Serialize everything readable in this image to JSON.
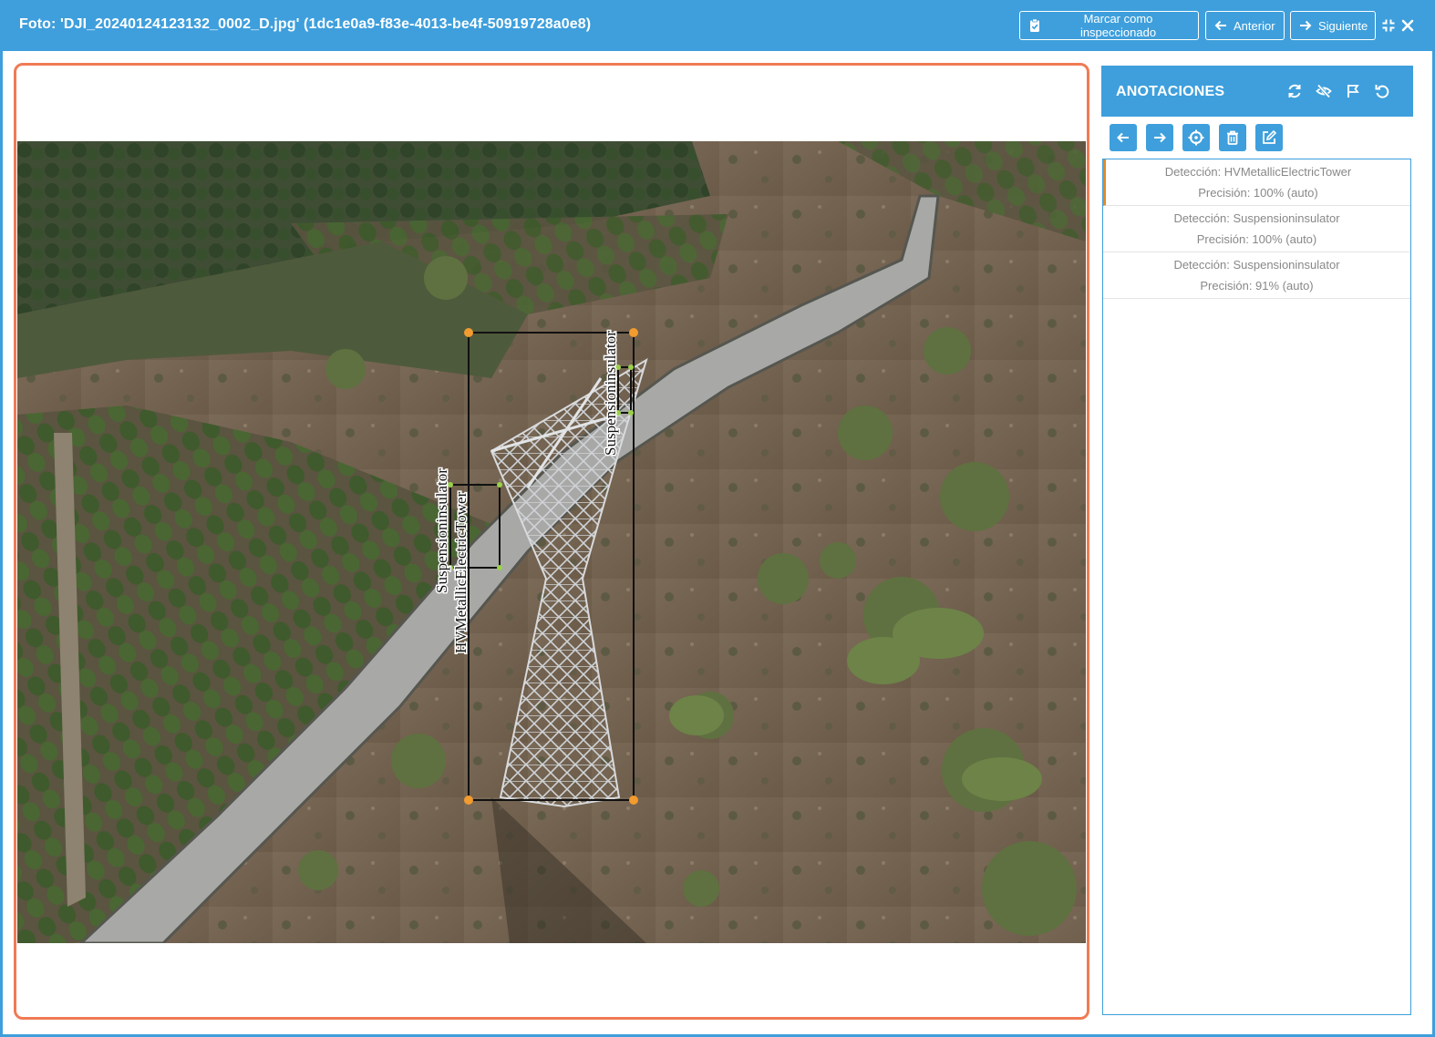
{
  "header": {
    "title": "Foto: 'DJI_20240124123132_0002_D.jpg' (1dc1e0a9-f83e-4013-be4f-50919728a0e8)",
    "buttons": {
      "mark_inspected": "Marcar como inspeccionado",
      "previous": "Anterior",
      "next": "Siguiente"
    },
    "icons": {
      "collapse": "collapse-icon",
      "close": "close-icon"
    }
  },
  "colors": {
    "brand_blue": "#3e9fdc",
    "viewer_border": "#ef7b54",
    "active_item": "#e08b2a",
    "handle_orange": "#f29b2e",
    "handle_green": "#9ad14a"
  },
  "viewer": {
    "detections": [
      {
        "label": "HVMetallicElectricTower",
        "label_orientation": "vertical"
      },
      {
        "label": "Suspensioninsulator",
        "label_orientation": "vertical"
      },
      {
        "label": "Suspensioninsulator",
        "label_orientation": "vertical"
      }
    ]
  },
  "annotations": {
    "title": "ANOTACIONES",
    "header_tools": [
      "refresh-icon",
      "eye-slash-icon",
      "flag-icon",
      "undo-icon"
    ],
    "toolbar": [
      "arrow-left-icon",
      "arrow-right-icon",
      "crosshair-icon",
      "trash-icon",
      "edit-icon"
    ],
    "items": [
      {
        "detection": "Detección: HVMetallicElectricTower",
        "precision": "Precisión: 100% (auto)",
        "active": true
      },
      {
        "detection": "Detección: Suspensioninsulator",
        "precision": "Precisión: 100% (auto)",
        "active": false
      },
      {
        "detection": "Detección: Suspensioninsulator",
        "precision": "Precisión: 91% (auto)",
        "active": false
      }
    ]
  }
}
